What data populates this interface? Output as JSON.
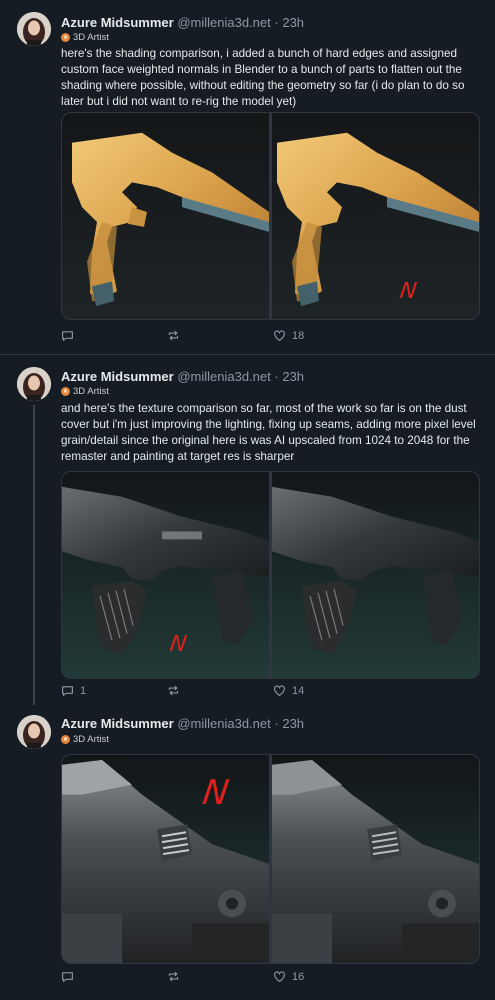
{
  "posts": [
    {
      "author": "Azure Midsummer",
      "handle": "@millenia3d.net",
      "time": "23h",
      "badge": "3D Artist",
      "text": "here's the shading comparison, i added a bunch of hard edges and assigned custom face weighted normals in Blender to a bunch of parts to flatten out the shading where possible, without editing the geometry so far (i do plan to do so later but i did not want to re-rig the model yet)",
      "annotation": "N",
      "replies": "",
      "reposts": "",
      "likes": "18"
    },
    {
      "author": "Azure Midsummer",
      "handle": "@millenia3d.net",
      "time": "23h",
      "badge": "3D Artist",
      "text": "and here's the texture comparison so far, most of the work so far is on the dust cover but i'm just improving the lighting, fixing up seams, adding more pixel level grain/detail since the original here is was AI upscaled from 1024 to 2048 for the remaster and painting at target res is sharper",
      "annotation": "N",
      "replies": "1",
      "reposts": "",
      "likes": "14"
    },
    {
      "author": "Azure Midsummer",
      "handle": "@millenia3d.net",
      "time": "23h",
      "badge": "3D Artist",
      "text": "",
      "annotation": "N",
      "replies": "",
      "reposts": "",
      "likes": "16"
    }
  ],
  "colors": {
    "background": "#161c24",
    "muted": "#8b98a5",
    "annotation_red": "#e0201c",
    "badge": "#e8873a"
  },
  "icons": [
    "reply-icon",
    "repost-icon",
    "like-icon"
  ]
}
